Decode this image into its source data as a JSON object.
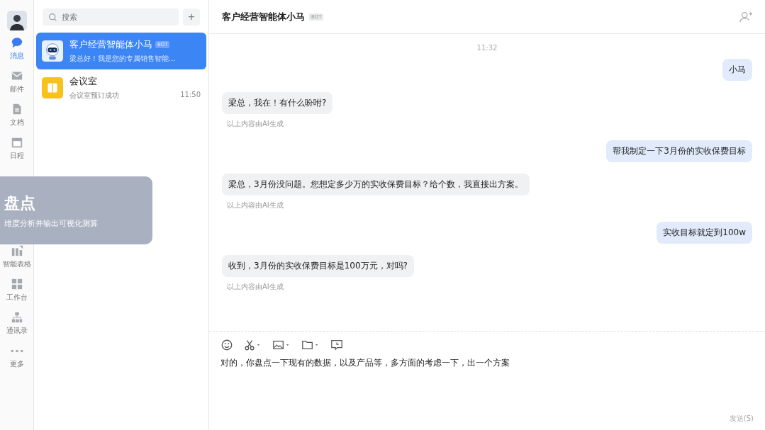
{
  "nav": [
    {
      "label": "消息",
      "selected": true
    },
    {
      "label": "邮件",
      "selected": false
    },
    {
      "label": "文档",
      "selected": false
    },
    {
      "label": "日程",
      "selected": false
    },
    {
      "label": "智能表格",
      "selected": false
    },
    {
      "label": "工作台",
      "selected": false
    },
    {
      "label": "通讯录",
      "selected": false
    },
    {
      "label": "更多",
      "selected": false
    }
  ],
  "search": {
    "placeholder": "搜索",
    "add": "+"
  },
  "conversations": [
    {
      "name": "客户经营智能体小马",
      "badge": "BOT",
      "preview": "梁总好！我是您的专属销售智能...",
      "selected": true
    },
    {
      "name": "会议室",
      "preview": "会议室预订成功",
      "time": "11:50",
      "selected": false
    }
  ],
  "chat": {
    "title": "客户经营智能体小马",
    "badge": "BOT",
    "timestamp": "11:32",
    "messages": [
      {
        "kind": "sent",
        "text": "小马"
      },
      {
        "kind": "received",
        "text": "梁总，我在！有什么吩咐?",
        "note": "以上内容由AI生成"
      },
      {
        "kind": "sent",
        "text": "帮我制定一下3月份的实收保费目标"
      },
      {
        "kind": "received",
        "text": "梁总，3月份没问题。您想定多少万的实收保费目标？给个数，我直接出方案。",
        "note": "以上内容由AI生成"
      },
      {
        "kind": "sent",
        "text": "实收目标就定到100w"
      },
      {
        "kind": "received",
        "text": "收到，3月份的实收保费目标是100万元，对吗?",
        "note": "以上内容由AI生成"
      }
    ],
    "draft": "对的，你盘点一下现有的数据，以及产品等，多方面的考虑一下，出一个方案",
    "send": "发送(S)"
  },
  "overlay": {
    "title": "盘点",
    "subtitle": "维度分析并输出可视化测算"
  }
}
